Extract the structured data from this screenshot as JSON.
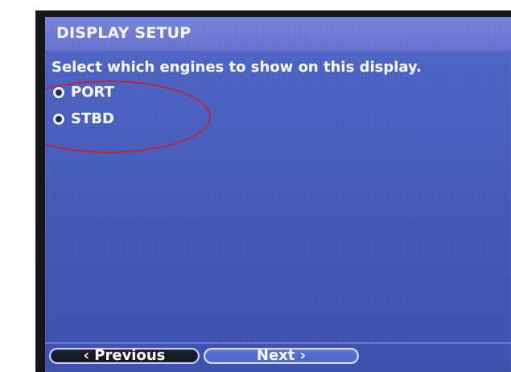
{
  "app": {
    "title": "DISPLAY SETUP"
  },
  "main": {
    "instruction": "Select which engines to show on this display.",
    "options": [
      {
        "label": "PORT",
        "icon": "radio-icon",
        "selected": true
      },
      {
        "label": "STBD",
        "icon": "radio-icon",
        "selected": true
      }
    ]
  },
  "footer": {
    "previous_label": "‹ Previous",
    "next_label": "Next ›"
  },
  "colors": {
    "background": "#ffffff",
    "bezel": "#14171b",
    "screen_blue": "#4a5fc0",
    "header_blue": "#6d79d3",
    "text": "#f6f8ff",
    "highlight_ring": "#b52a38",
    "button_dark": "#111521",
    "button_blue": "#4b62c7",
    "button_border": "#d7e0ff"
  }
}
